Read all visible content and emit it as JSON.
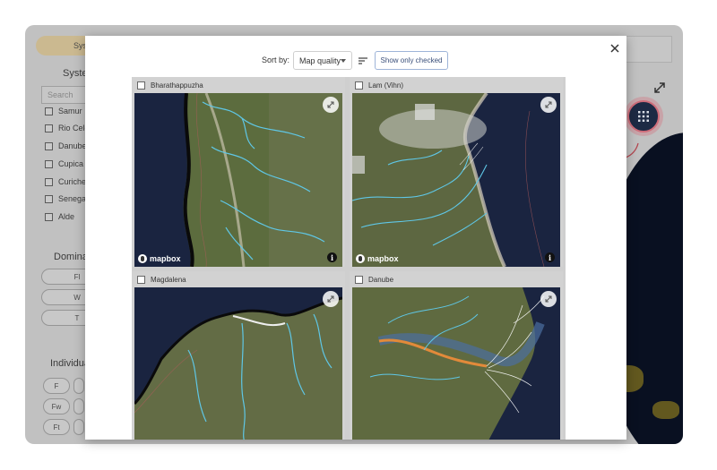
{
  "background": {
    "top_tab_label": "Sys",
    "systems_title": "Syste",
    "search_placeholder": "Search",
    "system_items": [
      "Samur",
      "Rio Cele",
      "Danube",
      "Cupica",
      "Curiche",
      "Senega",
      "Alde"
    ],
    "dominant_title": "Domina",
    "dominant_pills": [
      "Fl",
      "W",
      "T"
    ],
    "individual_title": "Individua",
    "individual_pills": [
      "F",
      "Fw",
      "Ft"
    ]
  },
  "modal": {
    "sort_label": "Sort by:",
    "sort_value": "Map quality",
    "show_checked_label": "Show only checked",
    "cards": [
      {
        "name": "Bharathappuzha",
        "has_logo": true,
        "logo_text": "mapbox"
      },
      {
        "name": "Lam (Vihn)",
        "has_logo": true,
        "logo_text": "mapbox"
      },
      {
        "name": "Magdalena",
        "has_logo": false
      },
      {
        "name": "Danube",
        "has_logo": false
      }
    ]
  },
  "colors": {
    "accent": "#cf6d7a",
    "button_bg": "#1d2a44",
    "water": "#1b2540",
    "land": "#5e6a3c",
    "river": "#5fc7e6"
  }
}
